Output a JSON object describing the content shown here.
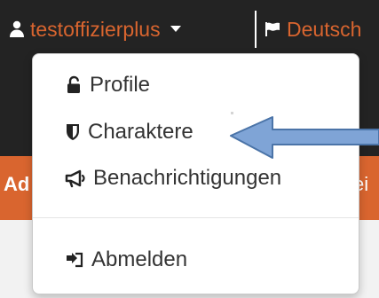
{
  "header": {
    "username": "testoffizierplus",
    "language_label": "Deutsch",
    "accent_color": "#d9652f",
    "icons": {
      "user": "user-icon",
      "caret": "caret-down-icon",
      "language": "flag-icon"
    }
  },
  "page_fragments": {
    "left_text": "Ad",
    "right_text": "ei"
  },
  "menu": {
    "items": [
      {
        "label": "Profile",
        "icon": "unlock-icon"
      },
      {
        "label": "Charaktere",
        "icon": "shield-icon"
      },
      {
        "label": "Benachrichtigungen",
        "icon": "bullhorn-icon"
      },
      {
        "label": "Abmelden",
        "icon": "sign-out-icon"
      }
    ]
  },
  "annotation": {
    "arrow_color": "#7fa4d6",
    "arrow_stroke": "#4b74a8",
    "points_to": "Charaktere"
  },
  "colors": {
    "topbar": "#232323",
    "orange_strip": "#d9652f",
    "menu_background": "#ffffff",
    "menu_text": "#333333",
    "page_background": "#f2f2f2"
  }
}
